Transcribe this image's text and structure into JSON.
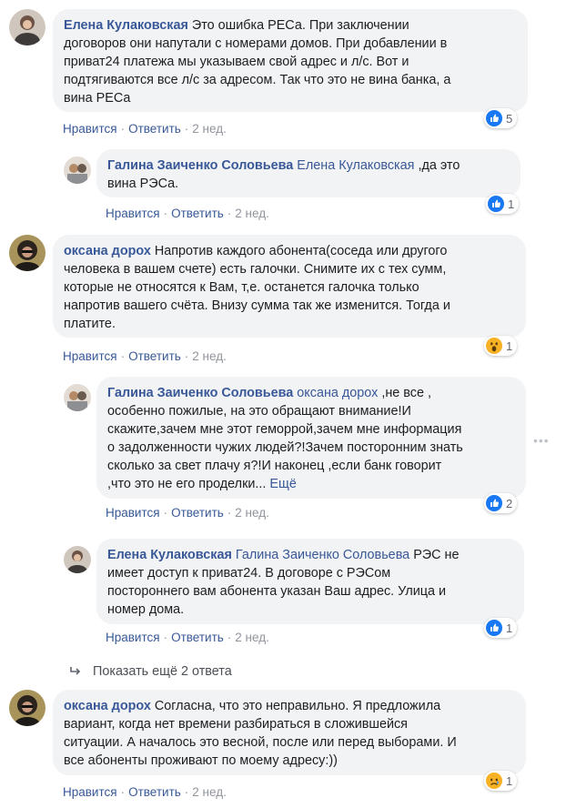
{
  "comments": [
    {
      "author": "Елена Кулаковская",
      "text_lines": [
        "Это ошибка РЕСа. При заключении",
        "договоров они напутали с номерами домов. При добавлении в",
        "приват24 платежа мы указываем свой адрес и л/с. Вот и",
        "подтягиваются все л/с за адресом. Так что это не вина банка, а",
        "вина РЕСа"
      ],
      "actions": {
        "like": "Нравится",
        "reply": "Ответить",
        "time": "2 нед."
      },
      "reaction": {
        "icon": "like-icon",
        "count": "5"
      }
    },
    {
      "author": "Галина Заиченко Соловьева",
      "mention": "Елена Кулаковская",
      "text_lines": [
        ",да это",
        "вина РЭСа."
      ],
      "actions": {
        "like": "Нравится",
        "reply": "Ответить",
        "time": "2 нед."
      },
      "reaction": {
        "icon": "like-icon",
        "count": "1"
      }
    },
    {
      "author": "оксана дорох",
      "text_lines": [
        "Напротив каждого абонента(соседа или другого",
        "человека в вашем счете) есть галочки. Снимите их с тех сумм,",
        "которые не относятся к Вам, т,е. останется галочка только",
        "напротив вашего счёта. Внизу сумма так же изменится. Тогда и",
        "платите."
      ],
      "actions": {
        "like": "Нравится",
        "reply": "Ответить",
        "time": "2 нед."
      },
      "reaction": {
        "icon": "wow-icon",
        "count": "1"
      }
    },
    {
      "author": "Галина Заиченко Соловьева",
      "mention": "оксана дорох",
      "text_lines": [
        ",не все ,",
        "особенно пожилые, на это обращают внимание!И",
        "скажите,зачем мне этот геморрой,зачем мне информация",
        "о задолженности чужих людей?!Зачем посторонним знать",
        "сколько за свет плачу я?!И наконец ,если банк говорит",
        ",что это не его проделки..."
      ],
      "see_more": "Ещё",
      "actions": {
        "like": "Нравится",
        "reply": "Ответить",
        "time": "2 нед."
      },
      "reaction": {
        "icon": "like-icon",
        "count": "2"
      }
    },
    {
      "author": "Елена Кулаковская",
      "mention": "Галина Заиченко Соловьева",
      "text_lines": [
        "РЭС не",
        "имеет доступ к приват24. В договоре с РЭСом",
        "постороннего вам абонента указан Ваш адрес. Улица и",
        "номер дома."
      ],
      "actions": {
        "like": "Нравится",
        "reply": "Ответить",
        "time": "2 нед."
      },
      "reaction": {
        "icon": "like-icon",
        "count": "1"
      }
    },
    {
      "author": "оксана дорох",
      "text_lines": [
        "Согласна, что это неправильно. Я предложила",
        "вариант, когда нет времени разбираться в сложившейся",
        "ситуации. А началось это весной, после или перед выборами. И",
        "все абоненты проживают по моему адресу:))"
      ],
      "actions": {
        "like": "Нравится",
        "reply": "Ответить",
        "time": "2 нед."
      },
      "reaction": {
        "icon": "sad-icon",
        "count": "1"
      }
    }
  ],
  "show_more_replies": "Показать ещё 2 ответа",
  "options_icon": "more-options-icon",
  "colors": {
    "link": "#385898",
    "bubble": "#f2f3f5",
    "like_blue": "#1877f2",
    "react_yellow": "#f7b125"
  }
}
